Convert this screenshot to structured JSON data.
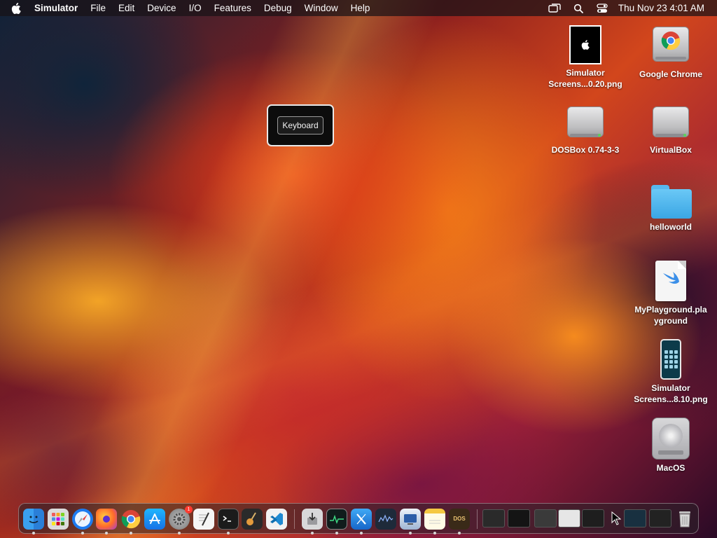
{
  "menubar": {
    "app_name": "Simulator",
    "items": [
      "File",
      "Edit",
      "Device",
      "I/O",
      "Features",
      "Debug",
      "Window",
      "Help"
    ],
    "clock": "Thu Nov 23  4:01 AM"
  },
  "popover": {
    "button_label": "Keyboard"
  },
  "desktop": {
    "icons": [
      {
        "label_line1": "Simulator",
        "label_line2": "Screens...0.20.png",
        "icon": "screenshot-thumbnail"
      },
      {
        "label_line1": "Google Chrome",
        "label_line2": "",
        "icon": "chrome-installer-drive"
      },
      {
        "label_line1": "DOSBox 0.74-3-3",
        "label_line2": "",
        "icon": "disk-image"
      },
      {
        "label_line1": "VirtualBox",
        "label_line2": "",
        "icon": "disk-image"
      },
      {
        "label_line1": "helloworld",
        "label_line2": "",
        "icon": "folder"
      },
      {
        "label_line1": "MyPlayground.pla",
        "label_line2": "yground",
        "icon": "swift-playground-doc"
      },
      {
        "label_line1": "Simulator",
        "label_line2": "Screens...8.10.png",
        "icon": "phone-screenshot"
      },
      {
        "label_line1": "MacOS",
        "label_line2": "",
        "icon": "hard-drive"
      }
    ]
  },
  "dock": {
    "apps": [
      {
        "name": "Finder",
        "icon": "finder-icon",
        "running": true
      },
      {
        "name": "Launchpad",
        "icon": "launchpad-icon",
        "running": false
      },
      {
        "name": "Safari",
        "icon": "safari-icon",
        "running": true
      },
      {
        "name": "Firefox",
        "icon": "firefox-icon",
        "running": true
      },
      {
        "name": "Google Chrome",
        "icon": "chrome-icon",
        "running": true
      },
      {
        "name": "App Store",
        "icon": "app-store-icon",
        "running": false
      },
      {
        "name": "System Settings",
        "icon": "settings-icon",
        "running": true,
        "badge": "1"
      },
      {
        "name": "TextEdit",
        "icon": "textedit-icon",
        "running": false
      },
      {
        "name": "Terminal",
        "icon": "terminal-icon",
        "running": true
      },
      {
        "name": "GarageBand",
        "icon": "garageband-icon",
        "running": false
      },
      {
        "name": "Visual Studio Code",
        "icon": "vscode-icon",
        "running": false
      },
      {
        "name": "Installer",
        "icon": "installer-icon",
        "running": true
      },
      {
        "name": "Activity Monitor",
        "icon": "activity-monitor-icon",
        "running": true
      },
      {
        "name": "Xcode",
        "icon": "xcode-icon",
        "running": true
      },
      {
        "name": "Instruments",
        "icon": "instruments-icon",
        "running": false
      },
      {
        "name": "Simulator",
        "icon": "simulator-icon",
        "running": true
      },
      {
        "name": "Notes",
        "icon": "notes-icon",
        "running": true
      },
      {
        "name": "DOSBox",
        "icon": "dosbox-icon",
        "running": true
      }
    ],
    "dosbox_label": "DOS",
    "minimized_windows": 8,
    "trash": "trash-icon"
  }
}
